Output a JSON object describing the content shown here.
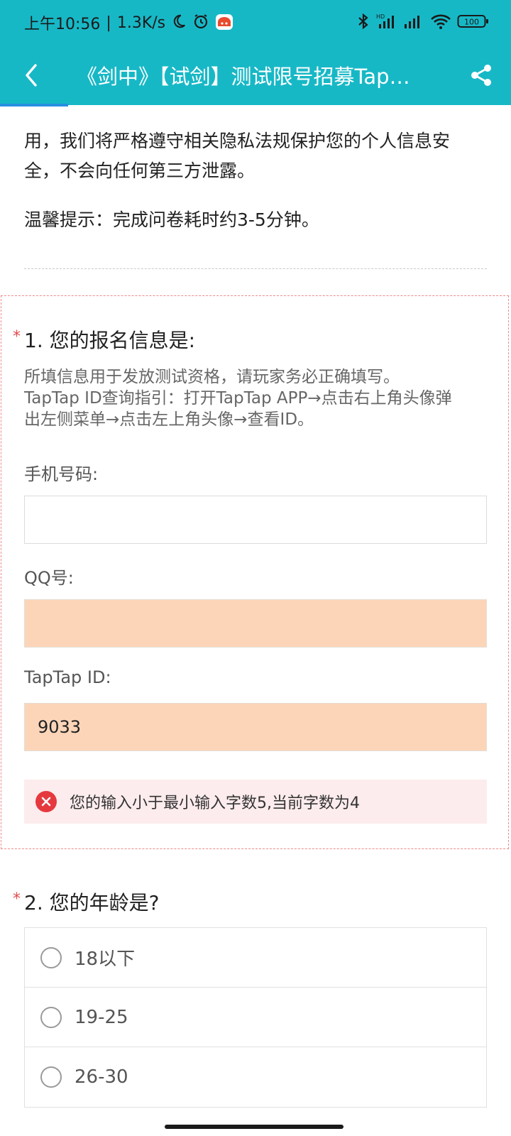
{
  "status_bar": {
    "time": "上午10:56",
    "net_speed": "1.3K/s",
    "battery": "100"
  },
  "nav": {
    "title": "《剑中》【试剑】测试限号招募Tap…"
  },
  "intro": {
    "line1": "用，我们将严格遵守相关隐私法规保护您的个人信息安",
    "line2": "全，不会向任何第三方泄露。",
    "tip": "温馨提示：完成问卷耗时约3-5分钟。"
  },
  "question1": {
    "required_mark": "*",
    "title": "1. 您的报名信息是:",
    "desc_line1": "所填信息用于发放测试资格，请玩家务必正确填写。",
    "desc_line2": "TapTap ID查询指引：打开TapTap APP→点击右上角头像弹",
    "desc_line3": "出左侧菜单→点击左上角头像→查看ID。",
    "fields": [
      {
        "label": "手机号码:",
        "value": ""
      },
      {
        "label": "QQ号:",
        "value": ""
      },
      {
        "label": "TapTap ID:",
        "value": "9033"
      }
    ],
    "error": "您的输入小于最小输入字数5,当前字数为4"
  },
  "question2": {
    "required_mark": "*",
    "title": "2. 您的年龄是?",
    "options": [
      "18以下",
      "19-25",
      "26-30"
    ]
  },
  "colors": {
    "header_bg": "#17b8c6",
    "error_red": "#e5393e",
    "error_field_bg": "#fcd5b9"
  }
}
